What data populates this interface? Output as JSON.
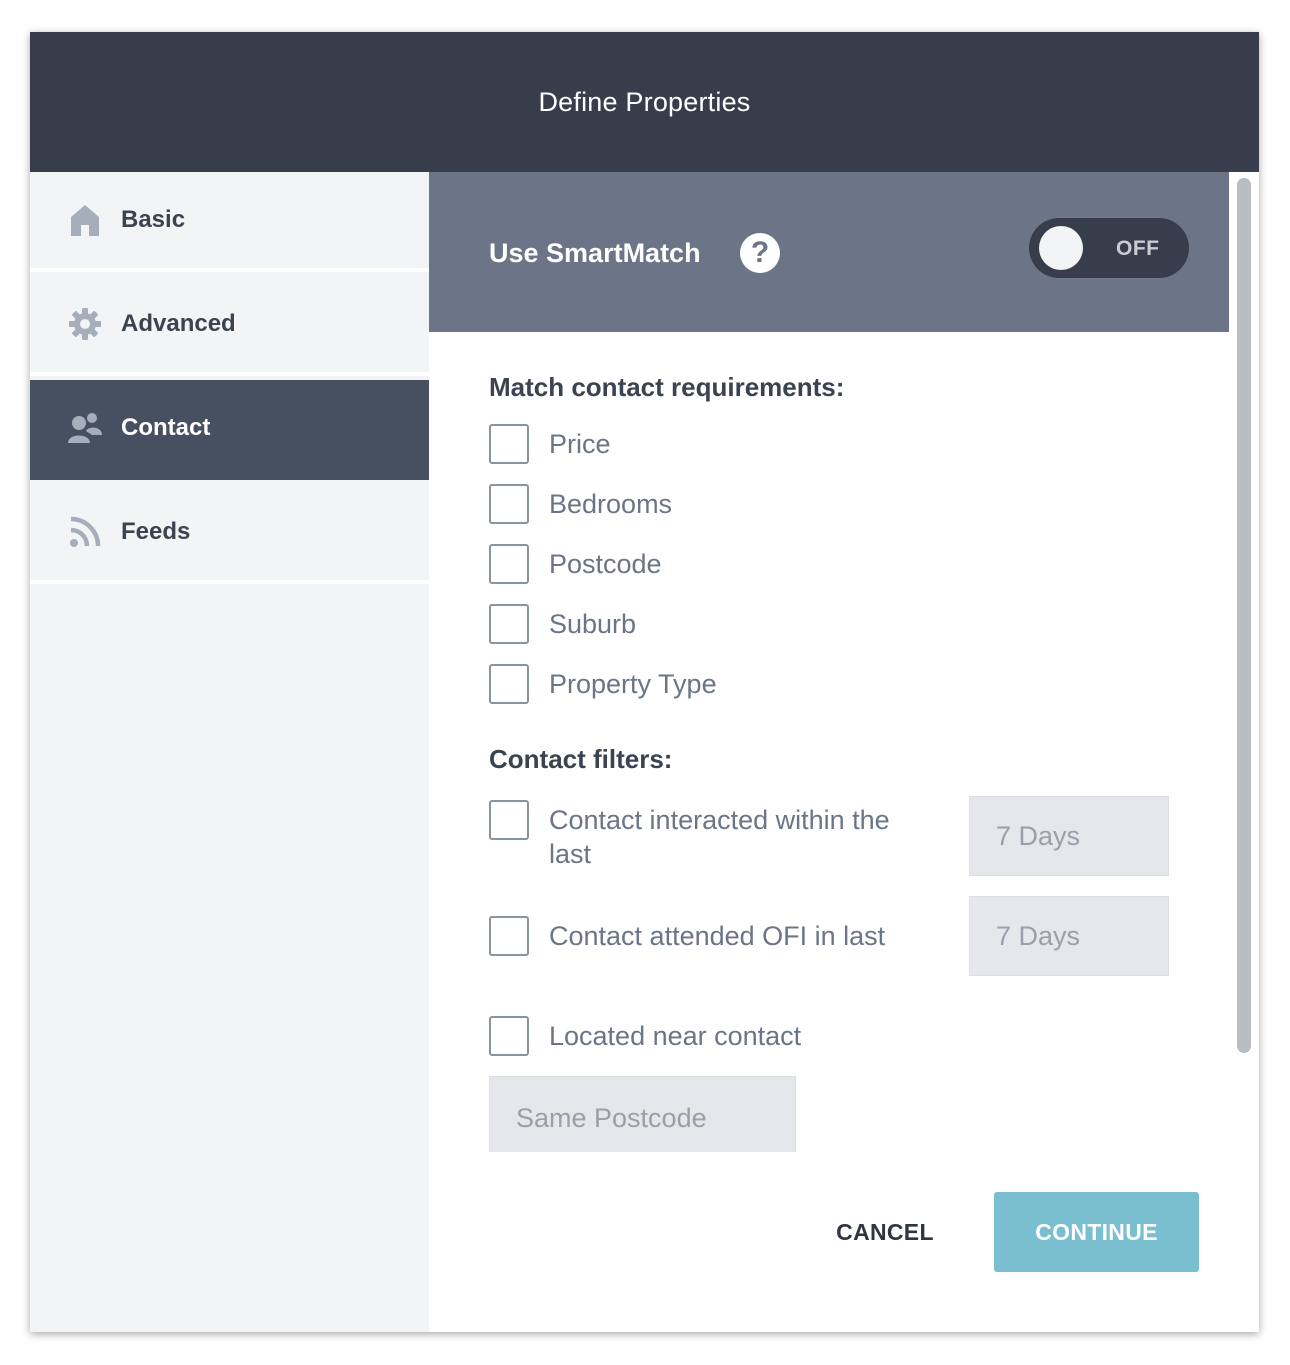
{
  "dialog": {
    "title": "Define Properties"
  },
  "sidebar": {
    "items": [
      {
        "label": "Basic",
        "icon": "home-icon"
      },
      {
        "label": "Advanced",
        "icon": "gear-icon"
      },
      {
        "label": "Contact",
        "icon": "contacts-icon",
        "active": true
      },
      {
        "label": "Feeds",
        "icon": "rss-icon"
      }
    ]
  },
  "smartmatch": {
    "title": "Use SmartMatch",
    "help_glyph": "?",
    "toggle_label": "OFF"
  },
  "requirements": {
    "title": "Match contact requirements:",
    "items": [
      "Price",
      "Bedrooms",
      "Postcode",
      "Suburb",
      "Property Type"
    ]
  },
  "filters": {
    "title": "Contact filters:",
    "interacted_label": "Contact interacted within the last",
    "interacted_value": "7 Days",
    "ofi_label": "Contact attended OFI in last",
    "ofi_value": "7 Days",
    "near_label": "Located near contact",
    "near_value": "Same Postcode"
  },
  "footer": {
    "cancel_label": "CANCEL",
    "continue_label": "CONTINUE"
  },
  "colors": {
    "header_bg": "#373d4a",
    "active_nav_bg": "#475061",
    "smartmatch_bg": "#6b7587",
    "continue_bg": "#7abfcf"
  }
}
